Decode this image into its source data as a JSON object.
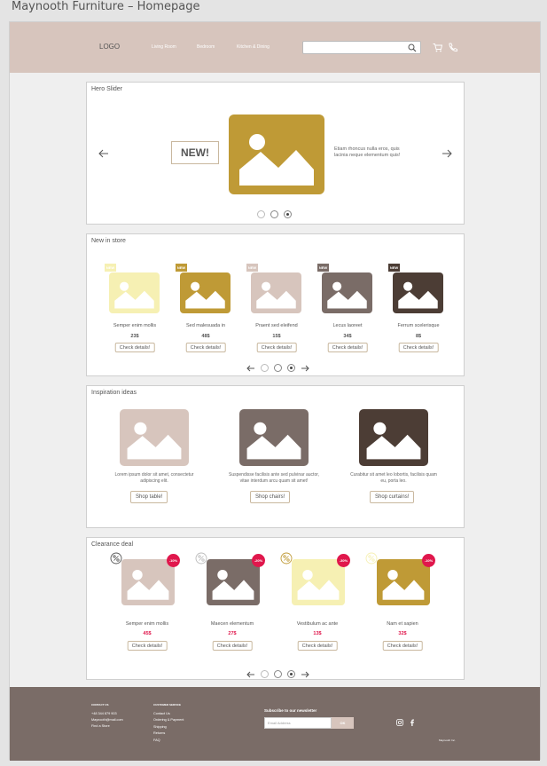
{
  "window_title": "Maynooth Furniture – Homepage",
  "header": {
    "logo": "LOGO",
    "nav": [
      "Living Room",
      "Bedroom",
      "Kitchen & Dining"
    ],
    "search_placeholder": ""
  },
  "hero": {
    "title": "Hero Slider",
    "badge": "NEW!",
    "text": "Etiam rhoncus nulla eros, quis lacinia neque elementum quis!",
    "image_color": "#bf9a36",
    "dots": 3,
    "active_dot": 3
  },
  "new_in_store": {
    "title": "New in store",
    "badge": "NEW",
    "button": "Check details!",
    "products": [
      {
        "name": "Semper enim mollis",
        "price": "23$",
        "color": "#f6f0b3",
        "badge_color": "#f6f0b3"
      },
      {
        "name": "Sed malesuada in",
        "price": "48$",
        "color": "#bf9a36",
        "badge_color": "#bf9a36"
      },
      {
        "name": "Praent sed eleifend",
        "price": "15$",
        "color": "#d7c5bd",
        "badge_color": "#d7c5bd"
      },
      {
        "name": "Lecus laoreet",
        "price": "34$",
        "color": "#7a6c67",
        "badge_color": "#7a6c67"
      },
      {
        "name": "Ferrum scelerisque",
        "price": "8$",
        "color": "#4c3d35",
        "badge_color": "#4c3d35"
      }
    ],
    "active_dot": 3
  },
  "inspiration": {
    "title": "Inspiration ideas",
    "items": [
      {
        "text": "Lorem ipsum dolor sit amet, consectetur adipiscing elit.",
        "button": "Shop table!",
        "color": "#d7c5bd"
      },
      {
        "text": "Suspendisse facilisis ante sed pulvinar auctor, vitae interdum arcu quam sit amet!",
        "button": "Shop chairs!",
        "color": "#7a6c67"
      },
      {
        "text": "Curabitur sit amet leo lobortis, facilisis quam eu, porta leo.",
        "button": "Shop curtains!",
        "color": "#4c3d35"
      }
    ]
  },
  "clearance": {
    "title": "Clearance deal",
    "button": "Check details!",
    "products": [
      {
        "name": "Semper enim mollis",
        "price": "45$",
        "discount": "-10%",
        "color": "#d7c5bd",
        "pct_color": "#555"
      },
      {
        "name": "Maecen elementum",
        "price": "27$",
        "discount": "-20%",
        "color": "#7a6c67",
        "pct_color": "#bbb"
      },
      {
        "name": "Vestibulum ac ante",
        "price": "13$",
        "discount": "-30%",
        "color": "#f6f0b3",
        "pct_color": "#bf9a36"
      },
      {
        "name": "Nam et sapien",
        "price": "32$",
        "discount": "-10%",
        "color": "#bf9a36",
        "pct_color": "#f6f0b3"
      }
    ],
    "active_dot": 3
  },
  "footer": {
    "contact_head": "CONTACT US",
    "contact_lines": [
      "+48 344 879 903",
      "Maynooth@mail.com",
      "Find a Store"
    ],
    "customer_head": "CUSTOMER SERVICE",
    "customer_lines": [
      "Contact Us",
      "Ordering & Payment",
      "Shipping",
      "Returns",
      "FAQ"
    ],
    "newsletter_title": "Subscribe to our newsletter",
    "email_placeholder": "Email Address",
    "ok_label": "OK",
    "copyright": "Maynooth Inc."
  }
}
